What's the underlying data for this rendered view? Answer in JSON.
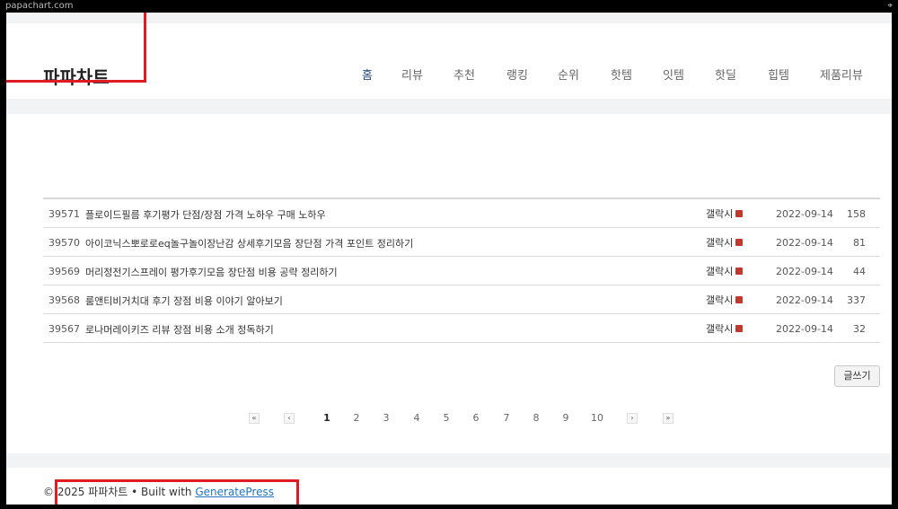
{
  "browser": {
    "url": "papachart.com"
  },
  "site": {
    "logo": "파파차트"
  },
  "nav": {
    "items": [
      "홈",
      "리뷰",
      "추천",
      "랭킹",
      "순위",
      "핫템",
      "잇템",
      "핫딜",
      "힙템",
      "제품리뷰"
    ],
    "active": "홈"
  },
  "board": {
    "rows": [
      {
        "num": "39571",
        "title": "플로이드필름 후기평가 단점/장점 가격 노하우 구매 노하우",
        "author": "갤락시",
        "date": "2022-09-14",
        "views": "158"
      },
      {
        "num": "39570",
        "title": "아이코닉스뽀로로eq놀구놀이장난감 상세후기모음 장단점 가격 포인트 정리하기",
        "author": "갤락시",
        "date": "2022-09-14",
        "views": "81"
      },
      {
        "num": "39569",
        "title": "머리정전기스프레이 평가후기모음 장단점 비용 공략 정리하기",
        "author": "갤락시",
        "date": "2022-09-14",
        "views": "44"
      },
      {
        "num": "39568",
        "title": "룸앤티비거치대 후기 장점 비용 이야기 알아보기",
        "author": "갤락시",
        "date": "2022-09-14",
        "views": "337"
      },
      {
        "num": "39567",
        "title": "로나머레이키즈 리뷰 장점 비용 소개 정독하기",
        "author": "갤락시",
        "date": "2022-09-14",
        "views": "32"
      }
    ],
    "write_label": "글쓰기"
  },
  "pagination": {
    "first": "«",
    "prev": "‹",
    "pages": [
      "1",
      "2",
      "3",
      "4",
      "5",
      "6",
      "7",
      "8",
      "9",
      "10"
    ],
    "current": "1",
    "next": "›",
    "last": "»"
  },
  "footer": {
    "prefix": "© 2025 파파차트 • Built with ",
    "link_text": "GeneratePress"
  },
  "colors": {
    "highlight": "#e01b24",
    "nav_active": "#2a4d7a",
    "link": "#1e73be"
  }
}
